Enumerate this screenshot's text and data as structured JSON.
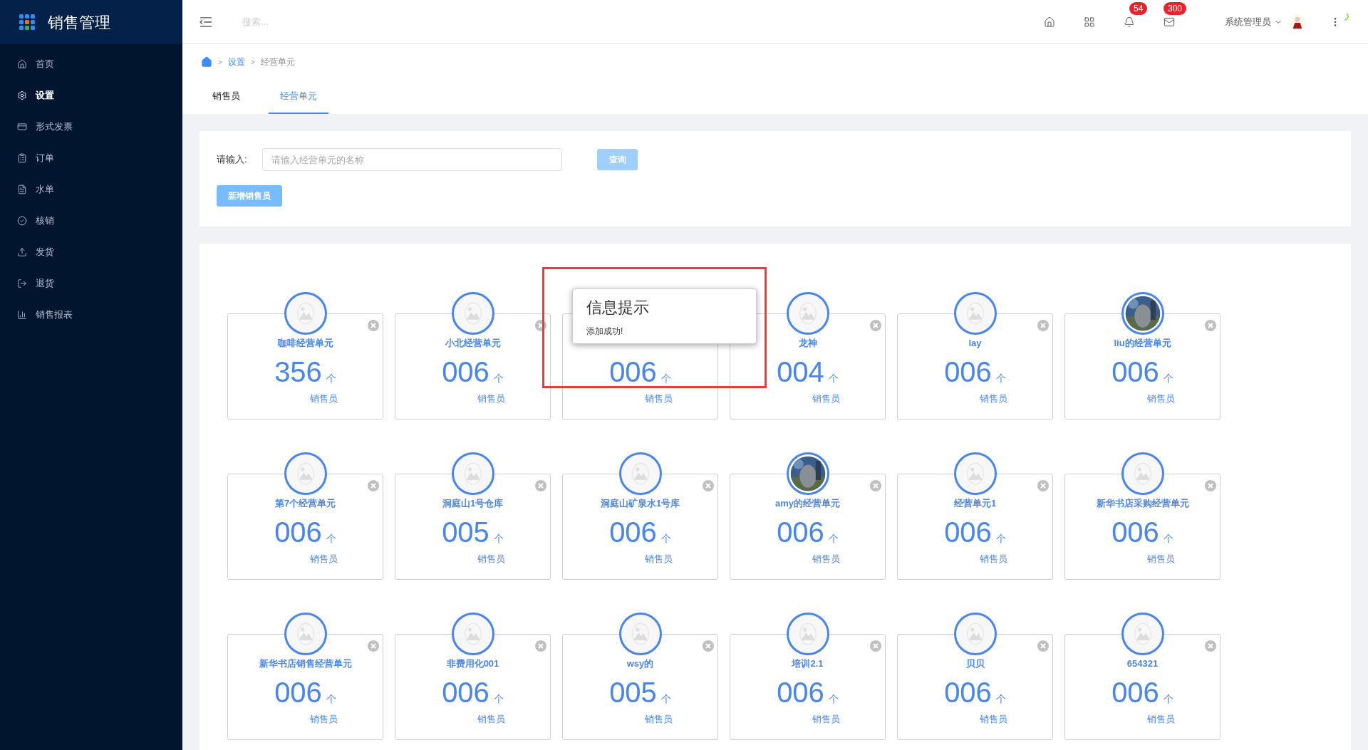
{
  "sidebar": {
    "title": "销售管理",
    "items": [
      {
        "label": "首页",
        "selected": false
      },
      {
        "label": "设置",
        "selected": true
      },
      {
        "label": "形式发票",
        "selected": false
      },
      {
        "label": "订单",
        "selected": false
      },
      {
        "label": "水单",
        "selected": false
      },
      {
        "label": "核销",
        "selected": false
      },
      {
        "label": "发货",
        "selected": false
      },
      {
        "label": "退货",
        "selected": false
      },
      {
        "label": "销售报表",
        "selected": false
      }
    ]
  },
  "header": {
    "search_placeholder": "搜索...",
    "notifications": "54",
    "messages": "300",
    "user": "系统管理员"
  },
  "breadcrumb": [
    {
      "separator": ">",
      "label": "设置"
    },
    {
      "separator": ">",
      "label": "经营单元"
    }
  ],
  "tabs": [
    {
      "label": "销售员",
      "selected": false
    },
    {
      "label": "经营单元",
      "selected": true
    }
  ],
  "search_form": {
    "label": "请输入:",
    "placeholder": "请输入经营单元的名称",
    "query_button": "查询",
    "add_button": "新增销售员"
  },
  "units": [
    {
      "name": "咖啡经营单元",
      "count": "356",
      "unit": "个",
      "label": "销售员",
      "photo": false
    },
    {
      "name": "小北经营单元",
      "count": "006",
      "unit": "个",
      "label": "销售员",
      "photo": false
    },
    {
      "count": "006",
      "unit": "个",
      "label": "销售员"
    },
    {
      "name": "龙神",
      "count": "004",
      "unit": "个",
      "label": "销售员",
      "photo": false
    },
    {
      "name": "lay",
      "count": "006",
      "unit": "个",
      "label": "销售员",
      "photo": false
    },
    {
      "name": "liu的经营单元",
      "count": "006",
      "unit": "个",
      "label": "销售员",
      "photo": true
    },
    {
      "name": "第7个经营单元",
      "count": "006",
      "unit": "个",
      "label": "销售员",
      "photo": false
    },
    {
      "name": "洞庭山1号仓库",
      "count": "005",
      "unit": "个",
      "label": "销售员",
      "photo": false
    },
    {
      "name": "洞庭山矿泉水1号库",
      "count": "006",
      "unit": "个",
      "label": "销售员",
      "photo": false
    },
    {
      "name": "amy的经营单元",
      "count": "006",
      "unit": "个",
      "label": "销售员",
      "photo": true
    },
    {
      "name": "经营单元1",
      "count": "006",
      "unit": "个",
      "label": "销售员",
      "photo": false
    },
    {
      "name": "新华书店采购经营单元",
      "count": "006",
      "unit": "个",
      "label": "销售员",
      "photo": false
    },
    {
      "name": "新华书店销售经营单元",
      "count": "006",
      "unit": "个",
      "label": "销售员",
      "photo": false
    },
    {
      "name": "非费用化001",
      "count": "006",
      "unit": "个",
      "label": "销售员",
      "photo": false
    },
    {
      "name": "wsy的",
      "count": "005",
      "unit": "个",
      "label": "销售员",
      "photo": false
    },
    {
      "name": "培训2.1",
      "count": "006",
      "unit": "个",
      "label": "销售员",
      "photo": false
    },
    {
      "name": "贝贝",
      "count": "006",
      "unit": "个",
      "label": "销售员",
      "photo": false
    },
    {
      "name": "654321",
      "count": "006",
      "unit": "个",
      "label": "销售员",
      "photo": false
    }
  ],
  "message_box": {
    "title": "信息提示",
    "text": "添加成功!"
  }
}
